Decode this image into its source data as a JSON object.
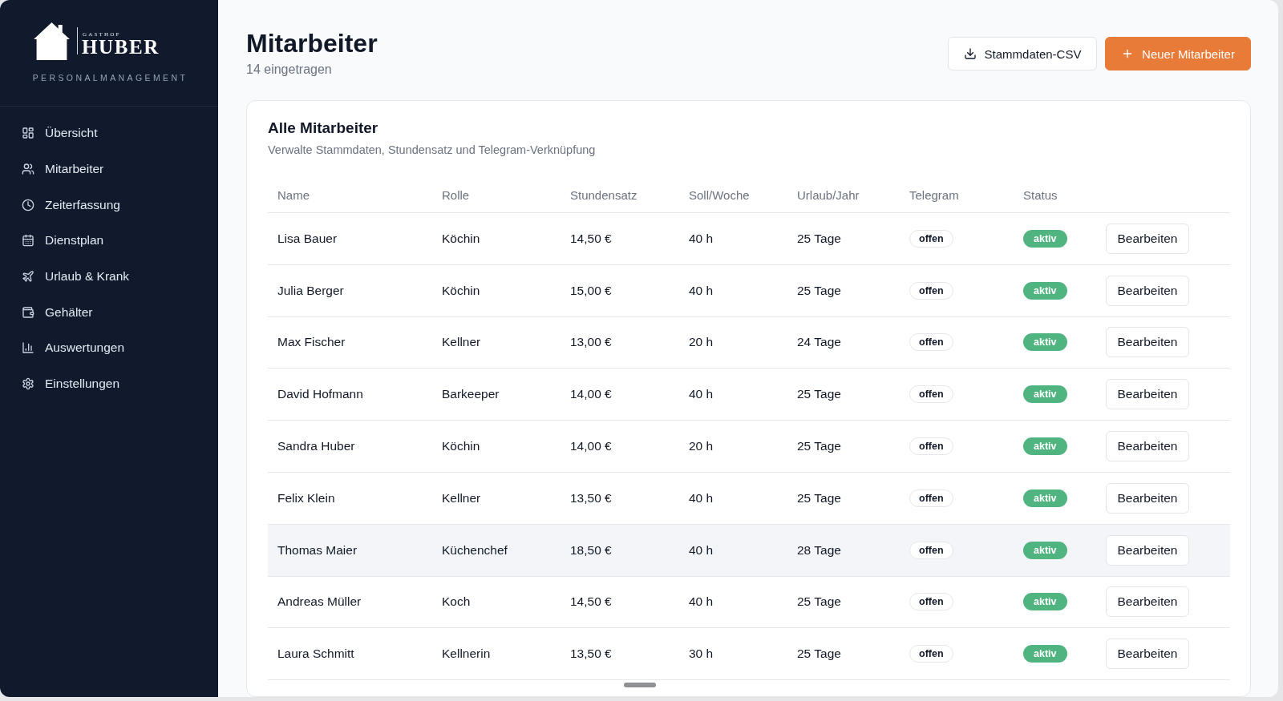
{
  "sidebar": {
    "brand": {
      "overline": "GASTHOF",
      "name": "HUBER",
      "tagline": "PERSONALMANAGEMENT"
    },
    "items": [
      {
        "label": "Übersicht"
      },
      {
        "label": "Mitarbeiter"
      },
      {
        "label": "Zeiterfassung"
      },
      {
        "label": "Dienstplan"
      },
      {
        "label": "Urlaub & Krank"
      },
      {
        "label": "Gehälter"
      },
      {
        "label": "Auswertungen"
      },
      {
        "label": "Einstellungen"
      }
    ]
  },
  "header": {
    "title": "Mitarbeiter",
    "subtitle": "14 eingetragen",
    "buttons": [
      {
        "label": "Stammdaten-CSV",
        "kind": "secondary"
      },
      {
        "label": "Neuer Mitarbeiter",
        "kind": "primary"
      }
    ]
  },
  "card": {
    "title": "Alle Mitarbeiter",
    "description": "Verwalte Stammdaten, Stundensatz und Telegram-Verknüpfung",
    "table": {
      "columns": [
        "Name",
        "Rolle",
        "Stundensatz",
        "Soll/Woche",
        "Urlaub/Jahr",
        "Telegram",
        "Status"
      ],
      "rows": [
        {
          "name": "Lisa Bauer",
          "role": "Köchin",
          "rate": "14,50 €",
          "hours": "40 h",
          "vacation": "25 Tage",
          "telegram": "offen",
          "status": "aktiv",
          "action": "Bearbeiten",
          "hovered": false
        },
        {
          "name": "Julia Berger",
          "role": "Köchin",
          "rate": "15,00 €",
          "hours": "40 h",
          "vacation": "25 Tage",
          "telegram": "offen",
          "status": "aktiv",
          "action": "Bearbeiten",
          "hovered": false
        },
        {
          "name": "Max Fischer",
          "role": "Kellner",
          "rate": "13,00 €",
          "hours": "20 h",
          "vacation": "24 Tage",
          "telegram": "offen",
          "status": "aktiv",
          "action": "Bearbeiten",
          "hovered": false
        },
        {
          "name": "David Hofmann",
          "role": "Barkeeper",
          "rate": "14,00 €",
          "hours": "40 h",
          "vacation": "25 Tage",
          "telegram": "offen",
          "status": "aktiv",
          "action": "Bearbeiten",
          "hovered": false
        },
        {
          "name": "Sandra Huber",
          "role": "Köchin",
          "rate": "14,00 €",
          "hours": "20 h",
          "vacation": "25 Tage",
          "telegram": "offen",
          "status": "aktiv",
          "action": "Bearbeiten",
          "hovered": false
        },
        {
          "name": "Felix Klein",
          "role": "Kellner",
          "rate": "13,50 €",
          "hours": "40 h",
          "vacation": "25 Tage",
          "telegram": "offen",
          "status": "aktiv",
          "action": "Bearbeiten",
          "hovered": false
        },
        {
          "name": "Thomas Maier",
          "role": "Küchenchef",
          "rate": "18,50 €",
          "hours": "40 h",
          "vacation": "28 Tage",
          "telegram": "offen",
          "status": "aktiv",
          "action": "Bearbeiten",
          "hovered": true
        },
        {
          "name": "Andreas Müller",
          "role": "Koch",
          "rate": "14,50 €",
          "hours": "40 h",
          "vacation": "25 Tage",
          "telegram": "offen",
          "status": "aktiv",
          "action": "Bearbeiten",
          "hovered": false
        },
        {
          "name": "Laura Schmitt",
          "role": "Kellnerin",
          "rate": "13,50 €",
          "hours": "30 h",
          "vacation": "25 Tage",
          "telegram": "offen",
          "status": "aktiv",
          "action": "Bearbeiten",
          "hovered": false
        }
      ]
    }
  }
}
